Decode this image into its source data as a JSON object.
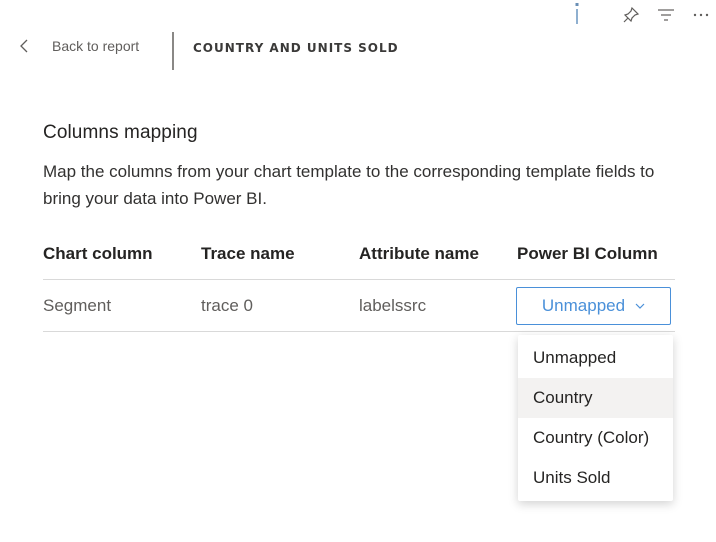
{
  "toolbar": {
    "icons": [
      "info-icon",
      "pin-icon",
      "filter-icon",
      "more-options-icon"
    ]
  },
  "header": {
    "back_label": "Back to report",
    "report_title": "COUNTRY AND UNITS SOLD"
  },
  "section": {
    "title": "Columns mapping",
    "description": "Map the columns from your chart template to the corresponding template fields to bring your data into Power BI."
  },
  "table": {
    "headers": [
      "Chart column",
      "Trace name",
      "Attribute name",
      "Power BI Column"
    ],
    "rows": [
      {
        "chart_column": "Segment",
        "trace_name": "trace 0",
        "attribute_name": "labelssrc",
        "powerbi_column": "Unmapped"
      }
    ]
  },
  "dropdown": {
    "options": [
      "Unmapped",
      "Country",
      "Country (Color)",
      "Units Sold"
    ],
    "hovered": "Country"
  },
  "colors": {
    "accent": "#4a90d9",
    "hover": "#f3f2f1"
  }
}
